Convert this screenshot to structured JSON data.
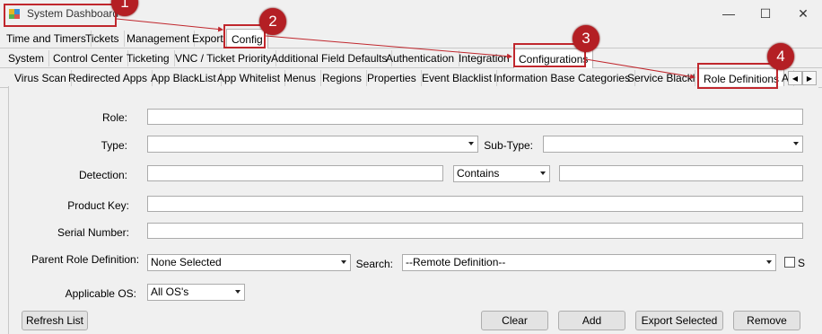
{
  "window": {
    "title": "System Dashboard",
    "minimize": "—",
    "maximize": "☐",
    "close": "✕"
  },
  "menu_tabs": [
    "Time and Timers",
    "Tickets",
    "Management",
    "Export",
    "Config"
  ],
  "config_tabs": [
    "System",
    "Control Center",
    "Ticketing",
    "VNC / Ticket Priority",
    "Additional Field Defaults",
    "Authentication",
    "Integration",
    "Configurations"
  ],
  "config_sub_tabs": [
    "Virus Scan",
    "Redirected Apps",
    "App BlackList",
    "App Whitelist",
    "Menus",
    "Regions",
    "Properties",
    "Event Blacklist",
    "Information Base Categories",
    "Service Blacklist",
    "Role Definitions",
    "A"
  ],
  "form": {
    "role_label": "Role:",
    "type_label": "Type:",
    "subtype_label": "Sub-Type:",
    "detection_label": "Detection:",
    "detection_mode": "Contains",
    "product_key_label": "Product Key:",
    "serial_number_label": "Serial Number:",
    "parent_role_label": "Parent Role Definition:",
    "parent_role_value": "None Selected",
    "search_label": "Search:",
    "search_value": "--Remote Definition--",
    "s_checkbox_label": "S",
    "applicable_os_label": "Applicable OS:",
    "applicable_os_value": "All OS's"
  },
  "buttons": {
    "refresh": "Refresh List",
    "clear": "Clear",
    "add": "Add",
    "export": "Export Selected",
    "remove": "Remove"
  },
  "annotations": [
    "1",
    "2",
    "3",
    "4"
  ],
  "colors": {
    "callout": "#c0272d",
    "badge": "#b41f24"
  }
}
